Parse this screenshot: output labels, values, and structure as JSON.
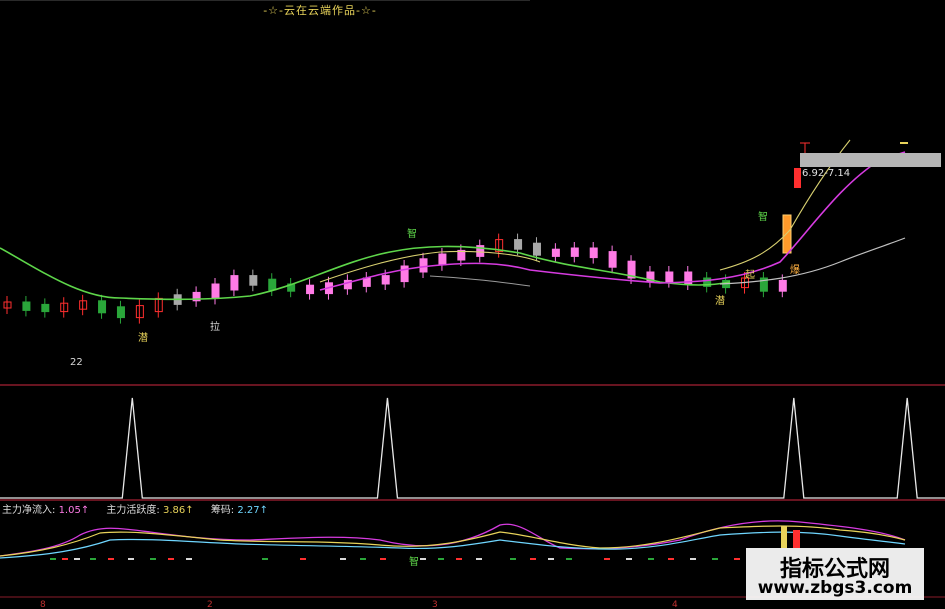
{
  "header": {
    "title": "-☆-云在云端作品-☆-"
  },
  "price_label": "6.92-7.14",
  "indicator_bar": {
    "item1_label": "主力净流入:",
    "item1_value": "1.05↑",
    "item2_label": "主力活跃度:",
    "item2_value": "3.86↑",
    "item3_label": "筹码:",
    "item3_value": "2.27↑"
  },
  "annotations": {
    "a22": "22",
    "a_la": "拉",
    "a_qian1": "潜",
    "a_qian2": "潜",
    "a_zhi1": "智",
    "a_zhi2": "智",
    "a_qi": "起",
    "a_bao": "爆",
    "a_zhi3": "智"
  },
  "watermark": {
    "line1": "指标公式网",
    "line2": "www.zbgs3.com"
  },
  "x_ticks": [
    "8",
    "2",
    "3",
    "4"
  ],
  "colors": {
    "up": "#ff2f2f",
    "down": "#2aa63a",
    "pink": "#ff7be6",
    "greenMA": "#5ed64a",
    "magentaMA": "#d63be0",
    "yellowMA": "#d8d070",
    "grey": "#a8a8a8",
    "panelBorder": "#8a1b2a"
  },
  "chart_data": {
    "type": "candlestick",
    "panels": [
      "price",
      "spike-signal",
      "fund-flow-lines"
    ],
    "candles_close_trend": [
      0.3,
      0.28,
      0.27,
      0.29,
      0.31,
      0.26,
      0.22,
      0.27,
      0.33,
      0.36,
      0.38,
      0.45,
      0.52,
      0.49,
      0.45,
      0.44,
      0.42,
      0.46,
      0.48,
      0.5,
      0.52,
      0.6,
      0.66,
      0.7,
      0.73,
      0.77,
      0.82,
      0.79,
      0.74,
      0.73,
      0.75,
      0.72,
      0.64,
      0.55,
      0.52,
      0.55,
      0.5,
      0.48,
      0.47,
      0.5,
      0.44,
      0.48,
      0.52,
      0.6,
      0.66,
      0.74,
      0.88
    ],
    "spike_signal": {
      "spikes_at": [
        0.14,
        0.41,
        0.84,
        0.96
      ]
    },
    "line_indicators": [
      "主力净流入",
      "主力活跃度",
      "筹码"
    ]
  }
}
